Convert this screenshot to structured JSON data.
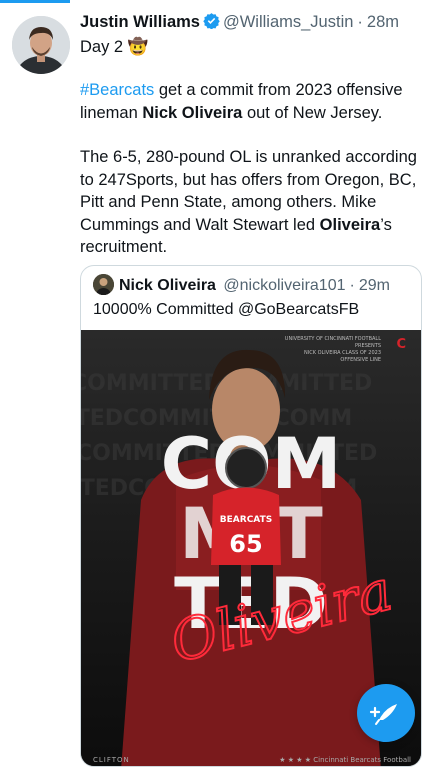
{
  "tweet": {
    "author_name": "Justin Williams",
    "author_handle": "@Williams_Justin",
    "time": "28m",
    "separator": "·",
    "day_text": "Day 2 🤠",
    "hashtag": "#Bearcats",
    "p1_a": " get a commit from 2023 offensive lineman ",
    "p1_bold": "Nick Oliveira",
    "p1_b": " out of New Jersey.",
    "p2_a": "The 6-5, 280-pound OL is unranked according to 247Sports, but has offers from Oregon, BC, Pitt and Penn State, among others. Mike Cummings and Walt Stewart led ",
    "p2_bold": "Oliveira",
    "p2_b": "’s recruitment."
  },
  "quote": {
    "author_name": "Nick Oliveira",
    "author_handle": "@nickoliveira101",
    "time": "29m",
    "separator": "·",
    "text": "10000% Committed @GoBearcatsFB",
    "poster": {
      "big_top": "COM",
      "big_mid": "MIT",
      "big_bot": "TED",
      "script_name": "Oliveira",
      "jersey_label": "BEARCATS",
      "jersey_number": "65",
      "small_top_lines": [
        "UNIVERSITY OF CINCINNATI FOOTBALL",
        "PRESENTS",
        "NICK OLIVEIRA CLASS OF 2023",
        "OFFENSIVE LINE"
      ],
      "footer_left": "CLIFTON",
      "footer_right": "★ ★ ★ ★  Cincinnati Bearcats Football"
    }
  },
  "compose": {
    "icon": "compose-icon"
  },
  "colors": {
    "accent": "#1d9bf0",
    "poster_red": "#d6232a"
  }
}
